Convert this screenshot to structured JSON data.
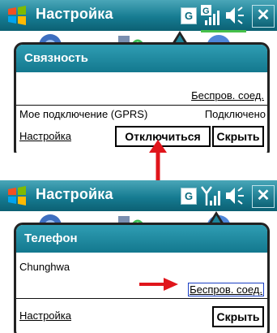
{
  "colors": {
    "titlebar": "#167c92",
    "bubble_header": "#1d8499",
    "link": "#1a3fc4",
    "annotation": "#e0151b",
    "signal_bar": "#45c04a"
  },
  "screenshot_top": {
    "titlebar": {
      "app_title": "Настройка",
      "badge_label": "G",
      "close_label": "✕"
    },
    "bubble": {
      "title": "Связность",
      "wireless_link": "Беспров. соед.",
      "connection_label": "Мое подключение (GPRS)",
      "connection_status": "Подключено",
      "settings_link": "Настройка",
      "disconnect_button": "Отключиться",
      "hide_button": "Скрыть"
    }
  },
  "screenshot_bottom": {
    "titlebar": {
      "app_title": "Настройка",
      "badge_label": "G",
      "close_label": "✕"
    },
    "bubble": {
      "title": "Телефон",
      "operator_name": "Chunghwa",
      "wireless_link": "Беспров. соед.",
      "settings_link": "Настройка",
      "hide_button": "Скрыть"
    }
  },
  "icons": [
    "windows-start-icon",
    "gprs-signal-icon",
    "antenna-signal-icon",
    "speaker-icon",
    "close-icon",
    "red-arrow-icon"
  ]
}
